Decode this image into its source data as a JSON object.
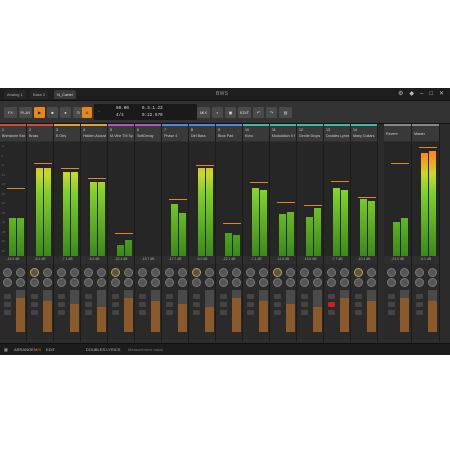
{
  "window": {
    "tabs": [
      "Analog 1",
      "Bass 2",
      "N_Cartel"
    ],
    "logo": "BWS",
    "top_icons": [
      "gear-icon",
      "bell-icon",
      "minimize-icon",
      "maximize-icon",
      "close-icon"
    ]
  },
  "transport": {
    "buttons": [
      "FX",
      "PLAY",
      "STOP",
      "REC",
      "LOOP"
    ],
    "tempo": "80.00",
    "signature": "4/4",
    "position": "6.3.1.23",
    "time": "0:22.570",
    "mode_buttons": [
      "MIX",
      "EDIT"
    ]
  },
  "tracks": [
    {
      "num": "1",
      "name": "Brimstone Kick",
      "color": "#d14d3a",
      "db": "-16.4 dB",
      "levels": [
        0.33,
        0.33
      ],
      "peak": 0.6
    },
    {
      "num": "2",
      "name": "Brass",
      "color": "#d14d3a",
      "db": "-6.2 dB",
      "levels": [
        0.77,
        0.77
      ],
      "peak": 0.82
    },
    {
      "num": "3",
      "name": "E.Gtrs",
      "color": "#e0a230",
      "db": "-7.1 dB",
      "levels": [
        0.74,
        0.74
      ],
      "peak": 0.77
    },
    {
      "num": "4",
      "name": "Hidden Acoustic",
      "color": "#e0a230",
      "db": "-5.6 dB",
      "levels": [
        0.65,
        0.65
      ],
      "peak": 0.68
    },
    {
      "num": "5",
      "name": "M-Vibe TM Synth",
      "color": "#b05ac0",
      "db": "-22.4 dB",
      "levels": [
        0.1,
        0.14
      ],
      "peak": 0.2
    },
    {
      "num": "6",
      "name": "SoftDecay",
      "color": "#b05ac0",
      "db": "-16.7 dB",
      "levels": [
        0.0,
        0.0
      ],
      "peak": 0.0
    },
    {
      "num": "7",
      "name": "Phase 4",
      "color": "#4f8ad6",
      "db": "-17.7 dB",
      "levels": [
        0.46,
        0.38
      ],
      "peak": 0.5
    },
    {
      "num": "8",
      "name": "Dirt Bass",
      "color": "#4f8ad6",
      "db": "-5.0 dB",
      "levels": [
        0.77,
        0.77
      ],
      "peak": 0.8
    },
    {
      "num": "9",
      "name": "Blow Pad",
      "color": "#4f8ad6",
      "db": "-22.1 dB",
      "levels": [
        0.2,
        0.18
      ],
      "peak": 0.29
    },
    {
      "num": "10",
      "name": "Echo",
      "color": "#3cb9a8",
      "db": "-7.1 dB",
      "levels": [
        0.6,
        0.58
      ],
      "peak": 0.65
    },
    {
      "num": "11",
      "name": "Modulation X Fx",
      "color": "#3cb9a8",
      "db": "-11.6 dB",
      "levels": [
        0.37,
        0.39
      ],
      "peak": 0.47
    },
    {
      "num": "12",
      "name": "Gentle Drops",
      "color": "#3cb9a8",
      "db": "-15.6 dB",
      "levels": [
        0.34,
        0.42
      ],
      "peak": 0.45
    },
    {
      "num": "13",
      "name": "Doubles Lyrics",
      "color": "#3cb9a8",
      "db": "-7.7 dB",
      "levels": [
        0.6,
        0.58
      ],
      "peak": 0.66
    },
    {
      "num": "14",
      "name": "Many Guitars",
      "color": "#3cb9a8",
      "db": "-10.1 dB",
      "levels": [
        0.5,
        0.48
      ],
      "peak": 0.52
    }
  ],
  "fx_tracks": [
    {
      "name": "Reverb",
      "db": "-23.4 dB",
      "levels": [
        0.3,
        0.33
      ],
      "peak": 0.82
    },
    {
      "name": "Master",
      "db": "-6.1 dB",
      "levels": [
        0.9,
        0.92
      ],
      "peak": 0.96
    }
  ],
  "scale_labels": [
    "+6",
    "0",
    "-6",
    "-12",
    "-18",
    "-24",
    "-30",
    "-36",
    "-42",
    "-48",
    "-54",
    "-60"
  ],
  "bottom": {
    "items": [
      "ARRANGE",
      "MIX",
      "EDIT"
    ],
    "status": "DOUBLES LYRICS",
    "status2": "Measurement value"
  }
}
